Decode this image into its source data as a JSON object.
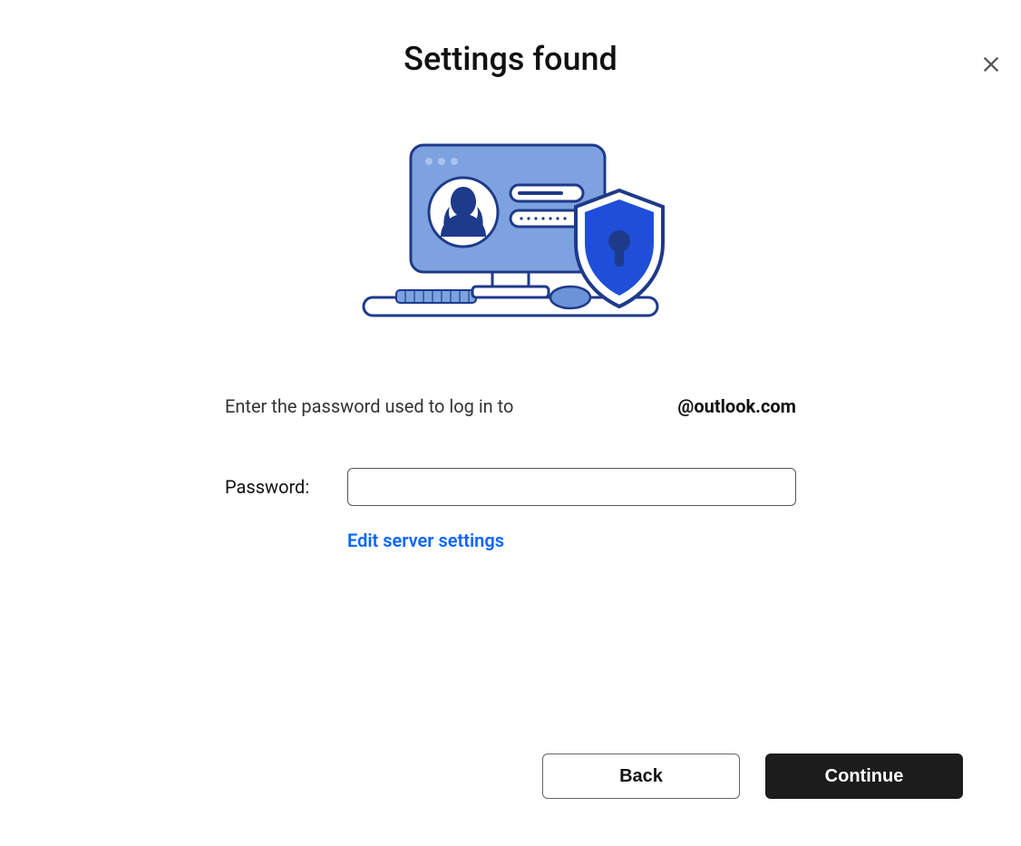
{
  "title": "Settings found",
  "instruction_prefix": "Enter the password used to log in to",
  "email_domain": "@outlook.com",
  "form": {
    "password_label": "Password:",
    "password_value": "",
    "edit_server_link": "Edit server settings"
  },
  "buttons": {
    "back": "Back",
    "continue": "Continue"
  }
}
